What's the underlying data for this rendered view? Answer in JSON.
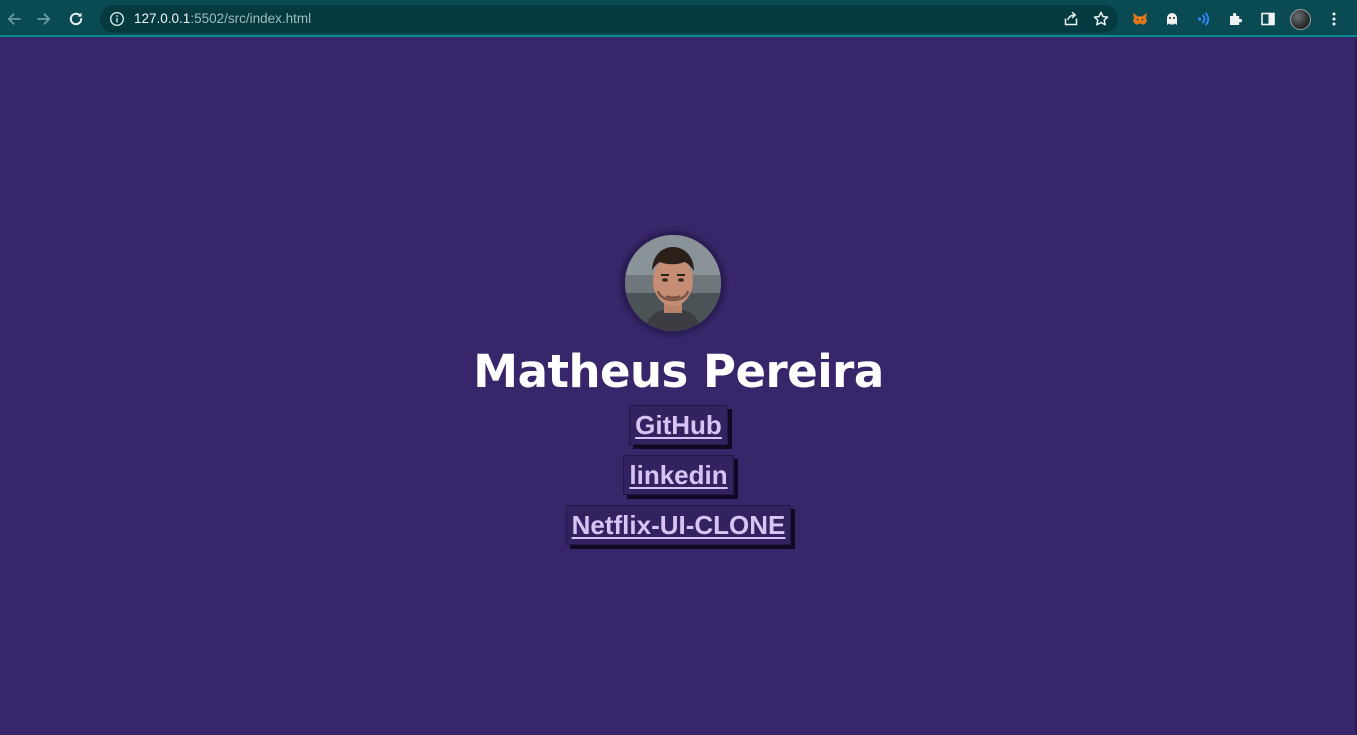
{
  "browser": {
    "url_host": "127.0.0.1",
    "url_path": ":5502/src/index.html",
    "icons": [
      "back-arrow-icon",
      "forward-arrow-icon",
      "reload-icon",
      "site-info-icon",
      "share-icon",
      "bookmark-star-icon",
      "metamask-fox-icon",
      "extension-ghost-icon",
      "extension-wave-icon",
      "extensions-puzzle-icon",
      "side-panel-icon",
      "profile-avatar-icon",
      "kebab-menu-icon"
    ]
  },
  "page": {
    "background_color": "#38266b",
    "name": "Matheus Pereira",
    "links": [
      {
        "label": "GitHub"
      },
      {
        "label": "linkedin"
      },
      {
        "label": "Netflix-UI-CLONE"
      }
    ]
  }
}
